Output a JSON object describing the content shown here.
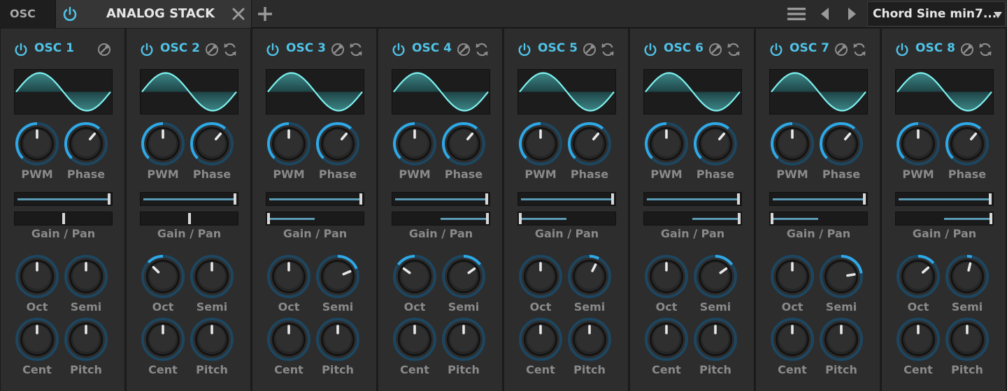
{
  "header": {
    "section_tab": "OSC",
    "preset_tab": "ANALOG STACK",
    "preset_select": "Chord Sine min7...",
    "accent": "#4fc3e8"
  },
  "labels": {
    "pwm": "PWM",
    "phase": "Phase",
    "gain_pan": "Gain / Pan",
    "oct": "Oct",
    "semi": "Semi",
    "cent": "Cent",
    "pitch": "Pitch"
  },
  "oscillators": [
    {
      "name": "OSC 1",
      "sync_icon": false,
      "gain": 1.0,
      "pan": 0.5,
      "pwm": 0.5,
      "phase": 0.65,
      "oct": 0.5,
      "semi": 0.5,
      "cent": 0.5,
      "pitch": 0.5
    },
    {
      "name": "OSC 2",
      "sync_icon": true,
      "gain": 1.0,
      "pan": 0.5,
      "pwm": 0.5,
      "phase": 0.65,
      "oct": 0.33,
      "semi": 0.5,
      "cent": 0.5,
      "pitch": 0.5
    },
    {
      "name": "OSC 3",
      "sync_icon": true,
      "gain": 1.0,
      "pan": 0.0,
      "pwm": 0.5,
      "phase": 0.65,
      "oct": 0.5,
      "semi": 0.75,
      "cent": 0.5,
      "pitch": 0.5
    },
    {
      "name": "OSC 4",
      "sync_icon": true,
      "gain": 1.0,
      "pan": 1.0,
      "pwm": 0.5,
      "phase": 0.65,
      "oct": 0.3,
      "semi": 0.7,
      "cent": 0.5,
      "pitch": 0.5
    },
    {
      "name": "OSC 5",
      "sync_icon": true,
      "gain": 1.0,
      "pan": 0.0,
      "pwm": 0.5,
      "phase": 0.65,
      "oct": 0.5,
      "semi": 0.6,
      "cent": 0.5,
      "pitch": 0.5
    },
    {
      "name": "OSC 6",
      "sync_icon": true,
      "gain": 1.0,
      "pan": 1.0,
      "pwm": 0.5,
      "phase": 0.65,
      "oct": 0.5,
      "semi": 0.7,
      "cent": 0.5,
      "pitch": 0.5
    },
    {
      "name": "OSC 7",
      "sync_icon": true,
      "gain": 1.0,
      "pan": 0.0,
      "pwm": 0.5,
      "phase": 0.65,
      "oct": 0.5,
      "semi": 0.8,
      "cent": 0.5,
      "pitch": 0.5
    },
    {
      "name": "OSC 8",
      "sync_icon": true,
      "gain": 1.0,
      "pan": 1.0,
      "pwm": 0.5,
      "phase": 0.65,
      "oct": 0.68,
      "semi": 0.55,
      "cent": 0.5,
      "pitch": 0.5
    }
  ]
}
